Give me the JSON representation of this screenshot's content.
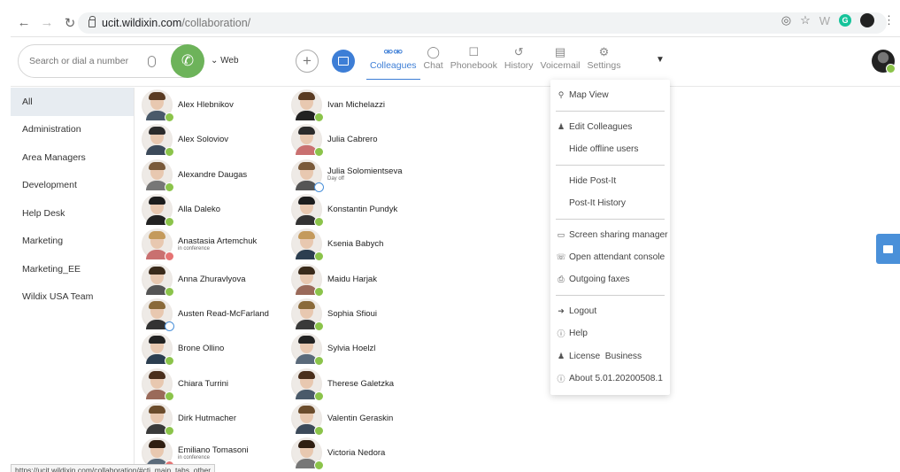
{
  "browser": {
    "url_domain": "ucit.wildixin.com",
    "url_path": "/collaboration/",
    "status_url": "https://ucit.wildixin.com/collaboration/#cti_main_tabs_other"
  },
  "header": {
    "search_placeholder": "Search or dial a number",
    "web_label": "Web",
    "tabs": [
      {
        "label": "Colleagues",
        "icon": "colleagues-icon",
        "active": true
      },
      {
        "label": "Chat",
        "icon": "chat-icon"
      },
      {
        "label": "Phonebook",
        "icon": "phonebook-icon"
      },
      {
        "label": "History",
        "icon": "history-icon"
      },
      {
        "label": "Voicemail",
        "icon": "voicemail-icon"
      },
      {
        "label": "Settings",
        "icon": "settings-icon"
      }
    ]
  },
  "sidebar": {
    "groups": [
      "All",
      "Administration",
      "Area Managers",
      "Development",
      "Help Desk",
      "Marketing",
      "Marketing_EE",
      "Wildix USA Team"
    ]
  },
  "colors": {
    "accent": "#3d7ed6",
    "online": "#8bc34a",
    "call": "#6db35a"
  },
  "contacts": {
    "col1": [
      {
        "name": "Alex Hlebnikov",
        "status": "online"
      },
      {
        "name": "Alex Soloviov",
        "status": "online"
      },
      {
        "name": "Alexandre Daugas",
        "status": "online"
      },
      {
        "name": "Alla Daleko",
        "status": "online"
      },
      {
        "name": "Anastasia Artemchuk",
        "sub": "in conference",
        "status": "busy"
      },
      {
        "name": "Anna Zhuravlyova",
        "status": "online"
      },
      {
        "name": "Austen Read-McFarland",
        "status": "away"
      },
      {
        "name": "Brone Ollino",
        "status": "online"
      },
      {
        "name": "Chiara Turrini",
        "status": "online"
      },
      {
        "name": "Dirk Hutmacher",
        "status": "online"
      },
      {
        "name": "Emiliano Tomasoni",
        "sub": "in conference",
        "status": "busy"
      }
    ],
    "col2": [
      {
        "name": "Ivan Michelazzi",
        "status": "online"
      },
      {
        "name": "Julia Cabrero",
        "status": "online"
      },
      {
        "name": "Julia Solomientseva",
        "sub": "Day off",
        "status": "away"
      },
      {
        "name": "Konstantin Pundyk",
        "status": "online"
      },
      {
        "name": "Ksenia Babych",
        "status": "online"
      },
      {
        "name": "Maidu Harjak",
        "status": "online"
      },
      {
        "name": "Sophia Sfioui",
        "status": "online"
      },
      {
        "name": "Sylvia Hoelzl",
        "status": "online"
      },
      {
        "name": "Therese Galetzka",
        "status": "online"
      },
      {
        "name": "Valentin Geraskin",
        "status": "online"
      },
      {
        "name": "Victoria Nedora",
        "status": "online"
      }
    ]
  },
  "menu": {
    "map_view": "Map View",
    "edit_colleagues": "Edit Colleagues",
    "hide_offline": "Hide offline users",
    "hide_postit": "Hide Post-It",
    "postit_history": "Post-It History",
    "screen_sharing": "Screen sharing manager",
    "attendant_console": "Open attendant console",
    "outgoing_faxes": "Outgoing faxes",
    "logout": "Logout",
    "help": "Help",
    "license": "License  Business",
    "about": "About 5.01.20200508.1"
  }
}
